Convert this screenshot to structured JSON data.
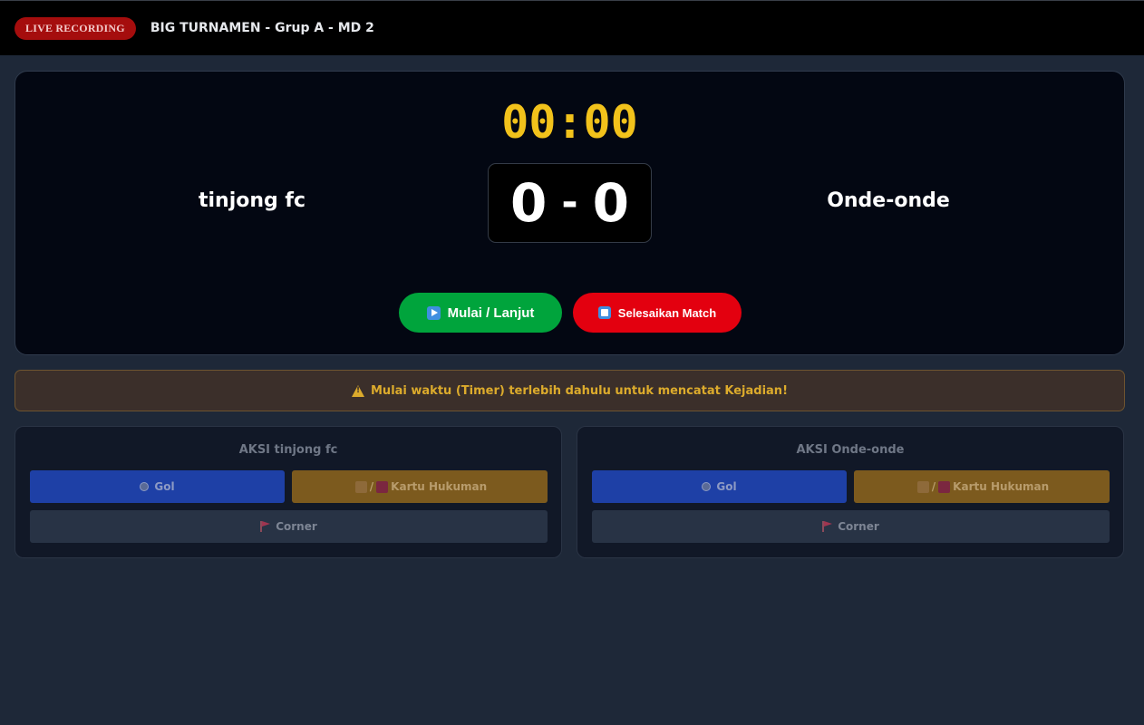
{
  "header": {
    "live_badge": "LIVE RECORDING",
    "title": "BIG TURNAMEN - Grup A - MD 2"
  },
  "scoreboard": {
    "timer": "00:00",
    "home_team": "tinjong fc",
    "away_team": "Onde-onde",
    "home_score": "0",
    "separator": "-",
    "away_score": "0",
    "start_label": "Mulai / Lanjut",
    "finish_label": "Selesaikan Match"
  },
  "warning": {
    "text": "Mulai waktu (Timer) terlebih dahulu untuk mencatat Kejadian!"
  },
  "panels": [
    {
      "title": "AKSI tinjong fc",
      "goal_label": "Gol",
      "card_sep": "/",
      "card_label": "Kartu Hukuman",
      "corner_label": "Corner"
    },
    {
      "title": "AKSI Onde-onde",
      "goal_label": "Gol",
      "card_sep": "/",
      "card_label": "Kartu Hukuman",
      "corner_label": "Corner"
    }
  ],
  "colors": {
    "live": "#a50d0d",
    "timer": "#f2c21b",
    "start": "#00a43c",
    "finish": "#e3000f",
    "goal": "#1e40a6",
    "card": "#7c5a1e",
    "corner": "#283345",
    "warning": "#dcab2c"
  },
  "icons": {
    "start": "play-icon",
    "finish": "stop-icon",
    "warning": "warning-icon",
    "goal": "soccer-ball-icon",
    "card_yellow": "yellow-card-icon",
    "card_red": "red-card-icon",
    "corner": "corner-flag-icon"
  }
}
